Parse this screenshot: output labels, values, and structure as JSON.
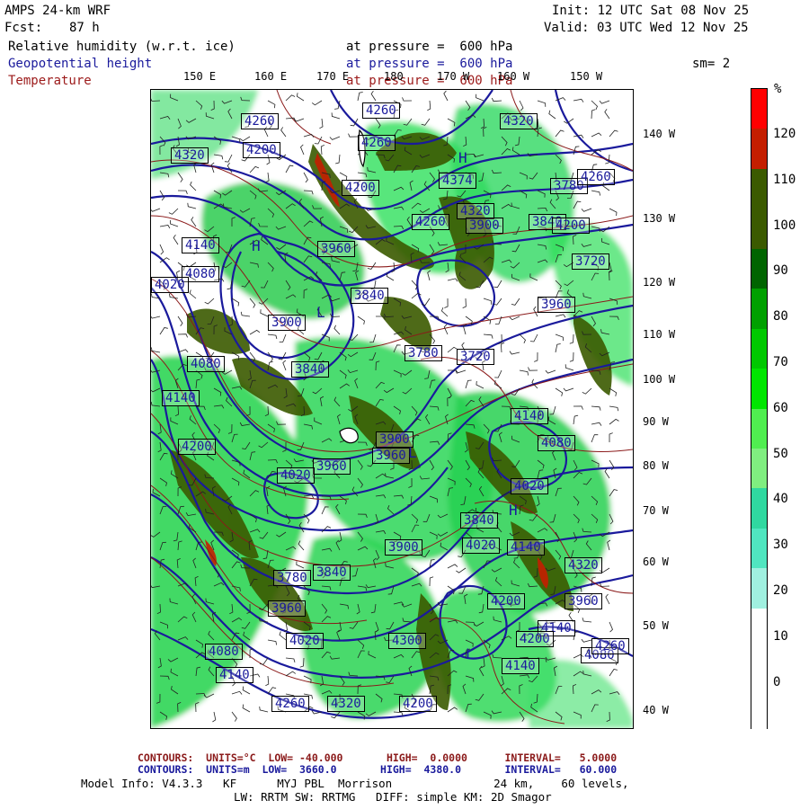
{
  "header": {
    "model": "AMPS 24-km WRF",
    "fcst_label": "Fcst:",
    "fcst_value": "87 h",
    "init": "Init: 12 UTC Sat 08 Nov 25",
    "valid": "Valid: 03 UTC Wed 12 Nov 25",
    "smooth": "sm= 2"
  },
  "fields": [
    {
      "name": "Relative humidity (w.r.t. ice)",
      "level": "at pressure =  600 hPa",
      "color": "#000000"
    },
    {
      "name": "Geopotential height",
      "level": "at pressure =  600 hPa",
      "color": "#1a1a9c"
    },
    {
      "name": "Temperature",
      "level": "at pressure =  600 hPa",
      "color": "#9c1a1a"
    }
  ],
  "top_lon_labels": [
    "150 E",
    "160 E",
    "170 E",
    "180",
    "170 W",
    "160 W",
    "150 W"
  ],
  "right_lon_labels": [
    "140 W",
    "130 W",
    "120 W",
    "110 W",
    "100 W",
    "90 W",
    "80 W",
    "70 W",
    "60 W",
    "50 W",
    "40 W"
  ],
  "height_labels": [
    "4260",
    "4200",
    "4320",
    "4260",
    "4374",
    "4320",
    "4260",
    "4200",
    "4140",
    "4080",
    "4020",
    "3960",
    "3900",
    "3840",
    "3780",
    "3720",
    "3960",
    "3900",
    "3840",
    "3780",
    "3720",
    "3840",
    "3900",
    "3960",
    "4020",
    "4080",
    "4140",
    "4200",
    "4260",
    "4320",
    "4260",
    "4200",
    "4140",
    "4080",
    "4020",
    "3960",
    "3900",
    "3840",
    "3780",
    "3840",
    "3960",
    "4020",
    "4080",
    "4140",
    "4200",
    "4260",
    "4320",
    "4300",
    "4020",
    "4200",
    "4140",
    "3960",
    "4080",
    "4140",
    "4200",
    "4320",
    "4260",
    "4140"
  ],
  "pressure_marks": [
    "H",
    "H",
    "L",
    "L",
    "H",
    "L"
  ],
  "colorbar": {
    "unit": "%",
    "labels": [
      "120",
      "110",
      "100",
      "90",
      "80",
      "70",
      "60",
      "50",
      "40",
      "30",
      "20",
      "10",
      "0"
    ],
    "colors": [
      "#ff0000",
      "#c41e00",
      "#3b5a00",
      "#3b5a00",
      "#006400",
      "#00a000",
      "#00c800",
      "#00e600",
      "#50ee50",
      "#80ee80",
      "#30d8a0",
      "#50e6c0",
      "#a0f0e0",
      "#ffffff",
      "#ffffff",
      "#ffffff"
    ]
  },
  "footer": {
    "temp_contours": "CONTOURS:  UNITS=°C  LOW= -40.000       HIGH=  0.0000      INTERVAL=   5.0000",
    "hgt_contours": "CONTOURS:  UNITS=m  LOW=  3660.0       HIGH=  4380.0       INTERVAL=   60.000",
    "model_info": "Model Info: V4.3.3   KF      MYJ PBL  Morrison               24 km,    60 levels,",
    "physics": "LW: RRTM SW: RRTMG   DIFF: simple KM: 2D Smagor"
  }
}
